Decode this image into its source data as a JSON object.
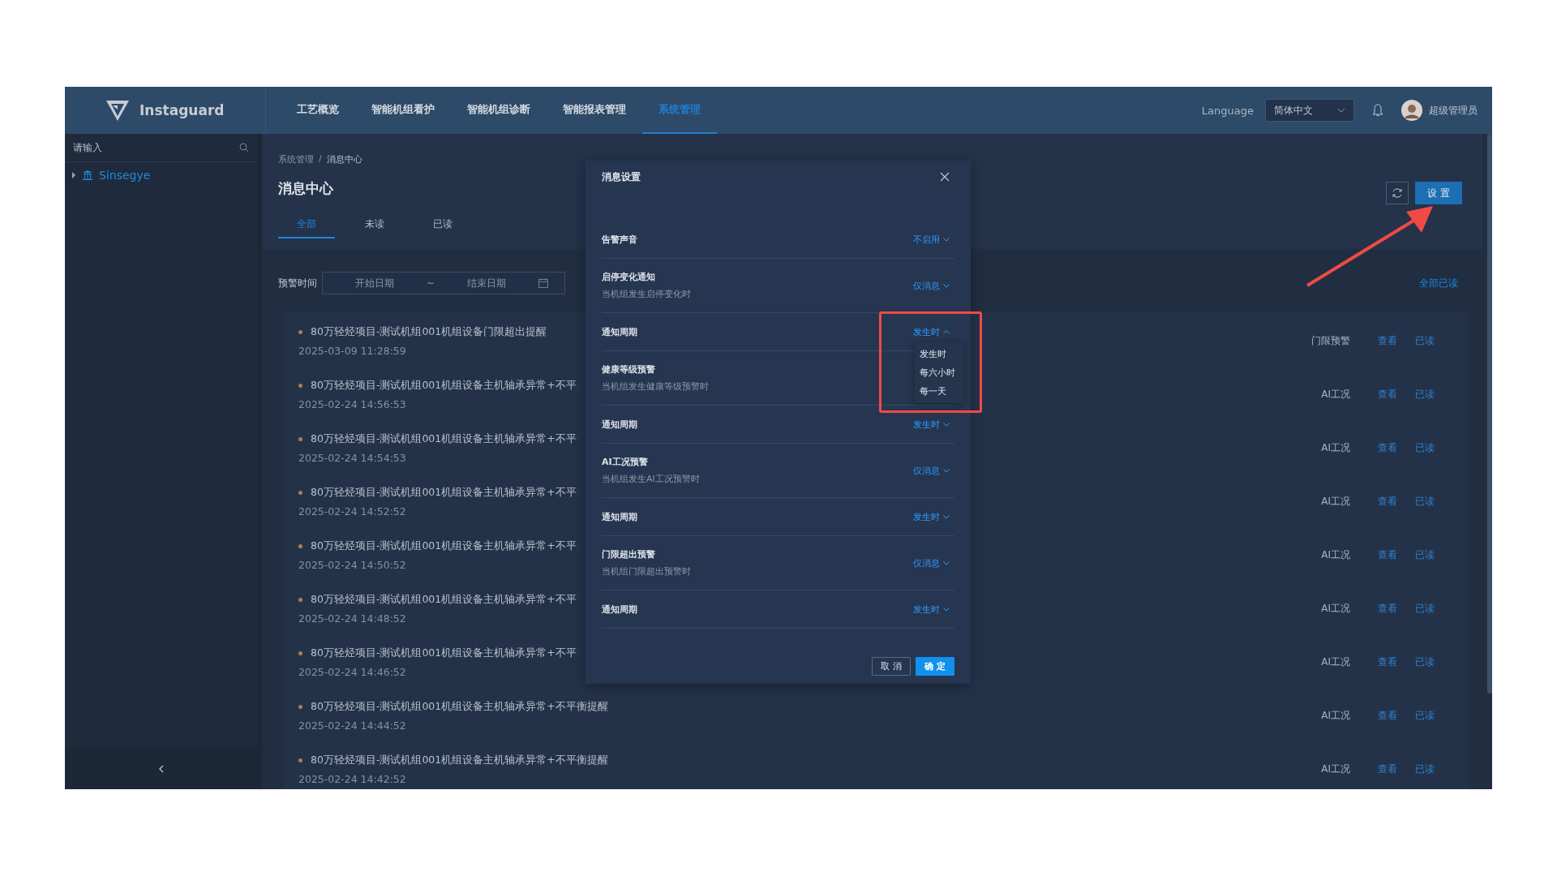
{
  "app": {
    "name": "Instaguard"
  },
  "nav": [
    {
      "label": "工艺概览",
      "selected": false
    },
    {
      "label": "智能机组看护",
      "selected": false
    },
    {
      "label": "智能机组诊断",
      "selected": false
    },
    {
      "label": "智能报表管理",
      "selected": false
    },
    {
      "label": "系统管理",
      "selected": true
    }
  ],
  "header": {
    "language_label": "Language",
    "language_value": "简体中文",
    "user": "超级管理员"
  },
  "sidebar": {
    "search_placeholder": "请输入",
    "tree": [
      {
        "label": "Sinsegye",
        "expanded": false
      }
    ]
  },
  "breadcrumb": {
    "items": [
      "系统管理",
      "消息中心"
    ],
    "separator": "/"
  },
  "page_title": "消息中心",
  "tabs": [
    {
      "label": "全部",
      "selected": true
    },
    {
      "label": "未读",
      "selected": false
    },
    {
      "label": "已读",
      "selected": false
    }
  ],
  "filter": {
    "label": "预警时间",
    "start_placeholder": "开始日期",
    "separator": "~",
    "end_placeholder": "结束日期"
  },
  "settings_button": "设置",
  "mark_all_read": "全部已读",
  "messages": [
    {
      "title": "80万轻烃项目-测试机组001机组设备门限超出提醒",
      "time": "2025-03-09 11:28:59",
      "type": "门限预警",
      "view": "查看",
      "read": "已读"
    },
    {
      "title": "80万轻烃项目-测试机组001机组设备主机轴承异常+不平",
      "time": "2025-02-24 14:56:53",
      "type": "AI工况",
      "view": "查看",
      "read": "已读"
    },
    {
      "title": "80万轻烃项目-测试机组001机组设备主机轴承异常+不平",
      "time": "2025-02-24 14:54:53",
      "type": "AI工况",
      "view": "查看",
      "read": "已读"
    },
    {
      "title": "80万轻烃项目-测试机组001机组设备主机轴承异常+不平",
      "time": "2025-02-24 14:52:52",
      "type": "AI工况",
      "view": "查看",
      "read": "已读"
    },
    {
      "title": "80万轻烃项目-测试机组001机组设备主机轴承异常+不平",
      "time": "2025-02-24 14:50:52",
      "type": "AI工况",
      "view": "查看",
      "read": "已读"
    },
    {
      "title": "80万轻烃项目-测试机组001机组设备主机轴承异常+不平",
      "time": "2025-02-24 14:48:52",
      "type": "AI工况",
      "view": "查看",
      "read": "已读"
    },
    {
      "title": "80万轻烃项目-测试机组001机组设备主机轴承异常+不平",
      "time": "2025-02-24 14:46:52",
      "type": "AI工况",
      "view": "查看",
      "read": "已读"
    },
    {
      "title": "80万轻烃项目-测试机组001机组设备主机轴承异常+不平衡提醒",
      "time": "2025-02-24 14:44:52",
      "type": "AI工况",
      "view": "查看",
      "read": "已读"
    },
    {
      "title": "80万轻烃项目-测试机组001机组设备主机轴承异常+不平衡提醒",
      "time": "2025-02-24 14:42:52",
      "type": "AI工况",
      "view": "查看",
      "read": "已读"
    }
  ],
  "dialog": {
    "title": "消息设置",
    "settings": [
      {
        "label": "告警声音",
        "value": "不启用",
        "dropdown_open": false
      },
      {
        "label": "启停变化通知",
        "description": "当机组发生启停变化时",
        "value": "仅消息",
        "dropdown_open": false
      },
      {
        "label": "通知周期",
        "value": "发生时",
        "dropdown_open": true
      },
      {
        "label": "健康等级预警",
        "description": "当机组发生健康等级预警时"
      },
      {
        "label": "通知周期",
        "value": "发生时",
        "dropdown_open": false
      },
      {
        "label": "AI工况预警",
        "description": "当机组发生AI工况预警时",
        "value": "仅消息",
        "dropdown_open": false
      },
      {
        "label": "通知周期",
        "value": "发生时",
        "dropdown_open": false
      },
      {
        "label": "门限超出预警",
        "description": "当机组门限超出预警时",
        "value": "仅消息",
        "dropdown_open": false
      },
      {
        "label": "通知周期",
        "value": "发生时",
        "dropdown_open": false
      }
    ],
    "dropdown_options": [
      {
        "label": "发生时",
        "selected": false
      },
      {
        "label": "每六小时",
        "selected": false
      },
      {
        "label": "每一天",
        "selected": false
      }
    ],
    "buttons": [
      {
        "label": "取 消",
        "kind": "secondary"
      },
      {
        "label": "确 定",
        "kind": "primary"
      }
    ]
  }
}
